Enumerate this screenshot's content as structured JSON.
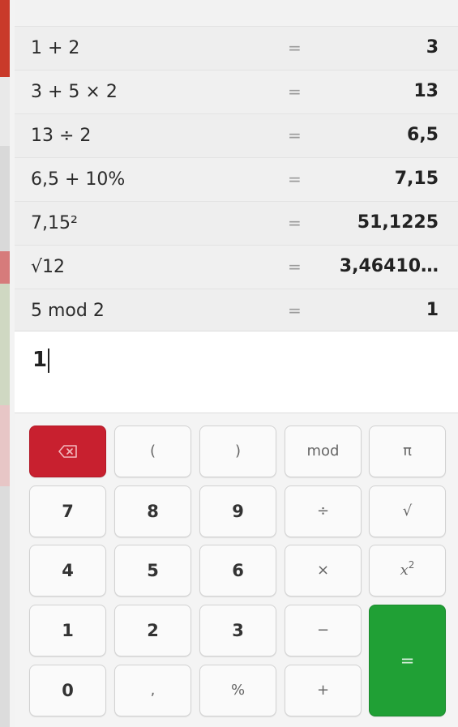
{
  "history": [
    {
      "expression": "1 + 2",
      "equals": "=",
      "result": "3"
    },
    {
      "expression": "3 + 5 × 2",
      "equals": "=",
      "result": "13"
    },
    {
      "expression": "13 ÷ 2",
      "equals": "=",
      "result": "6,5"
    },
    {
      "expression": "6,5 + 10%",
      "equals": "=",
      "result": "7,15"
    },
    {
      "expression": "7,15²",
      "equals": "=",
      "result": "51,1225"
    },
    {
      "expression": "√12",
      "equals": "=",
      "result": "3,46410…"
    },
    {
      "expression": "5 mod 2",
      "equals": "=",
      "result": "1"
    }
  ],
  "input": {
    "value": "1"
  },
  "keys": {
    "open_paren": "(",
    "close_paren": ")",
    "mod": "mod",
    "pi": "π",
    "seven": "7",
    "eight": "8",
    "nine": "9",
    "divide": "÷",
    "sqrt": "√",
    "four": "4",
    "five": "5",
    "six": "6",
    "multiply": "×",
    "square_base": "x",
    "square_exp": "2",
    "one": "1",
    "two": "2",
    "three": "3",
    "minus": "−",
    "equals": "=",
    "zero": "0",
    "comma": ",",
    "percent": "%",
    "plus": "+",
    "delete_icon": "backspace-icon"
  },
  "colors": {
    "delete_key": "#c8202f",
    "equals_key": "#20a035"
  }
}
